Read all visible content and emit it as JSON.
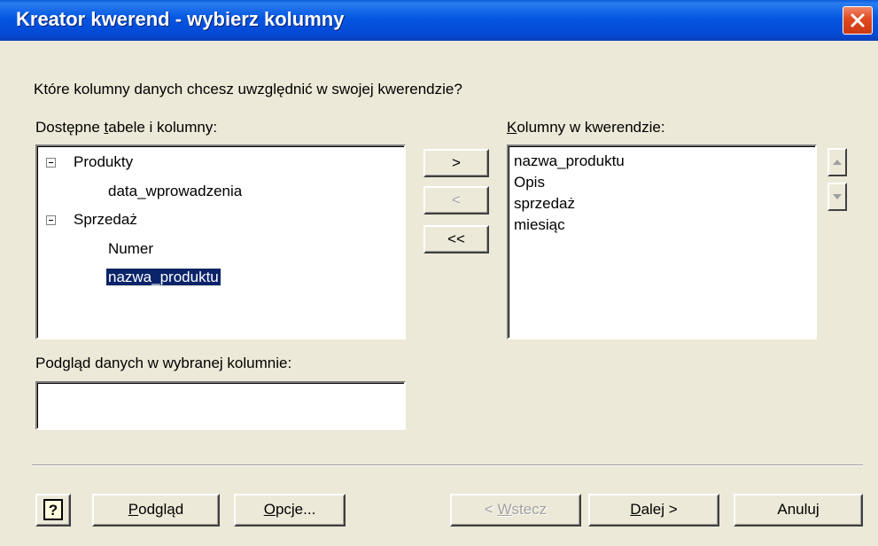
{
  "window": {
    "title": "Kreator kwerend - wybierz kolumny"
  },
  "prompt": "Które kolumny danych chcesz uwzględnić w swojej kwerendzie?",
  "available": {
    "label_pre": "Dostępne ",
    "label_key": "t",
    "label_post": "abele i kolumny:",
    "tree": [
      {
        "label": "Produkty",
        "expanded": true,
        "children": [
          "data_wprowadzenia"
        ]
      },
      {
        "label": "Sprzedaż",
        "expanded": true,
        "children": [
          "Numer",
          "nazwa_produktu"
        ]
      }
    ],
    "selected": "nazwa_produktu"
  },
  "query_columns": {
    "label_key": "K",
    "label_post": "olumny w kwerendzie:",
    "items": [
      "nazwa_produktu",
      "Opis",
      "sprzedaż",
      "miesiąc"
    ]
  },
  "move_buttons": {
    "add": ">",
    "remove": "<",
    "remove_all": "<<"
  },
  "preview": {
    "label": "Podgląd danych w wybranej kolumnie:",
    "value": ""
  },
  "footer": {
    "help_icon": "question-mark-icon",
    "preview_key": "P",
    "preview_post": "odgląd",
    "options_key": "O",
    "options_post": "pcje...",
    "back_pre": "< ",
    "back_key": "W",
    "back_post": "stecz",
    "next_key": "D",
    "next_post": "alej >",
    "cancel": "Anuluj"
  },
  "colors": {
    "titlebar": "#0456e2",
    "dialog_bg": "#ece9d8",
    "selection": "#0a246a",
    "close": "#e2491f"
  }
}
